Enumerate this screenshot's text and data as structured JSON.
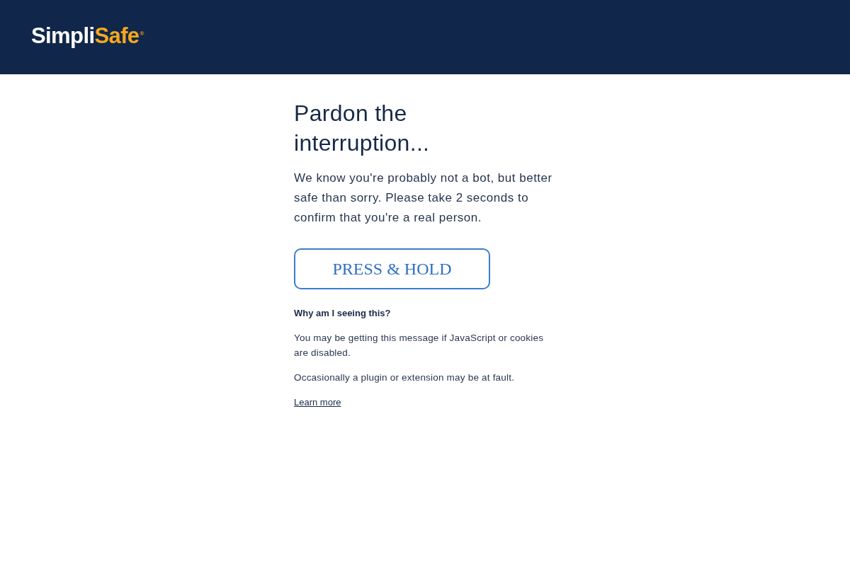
{
  "header": {
    "logo": {
      "primary": "Simpli",
      "accent": "Safe",
      "mark": "®"
    }
  },
  "main": {
    "heading": "Pardon the interruption...",
    "intro": "We know you're probably not a bot, but better safe than sorry. Please take 2 seconds to confirm that you're a real person.",
    "hold_button": {
      "label": "PRESS & HOLD"
    },
    "help": {
      "title": "Why am I seeing this?",
      "paragraphs": [
        "You may be getting this message if JavaScript or cookies are disabled.",
        "Occasionally a plugin or extension may be at fault."
      ],
      "link": "Learn more"
    }
  }
}
